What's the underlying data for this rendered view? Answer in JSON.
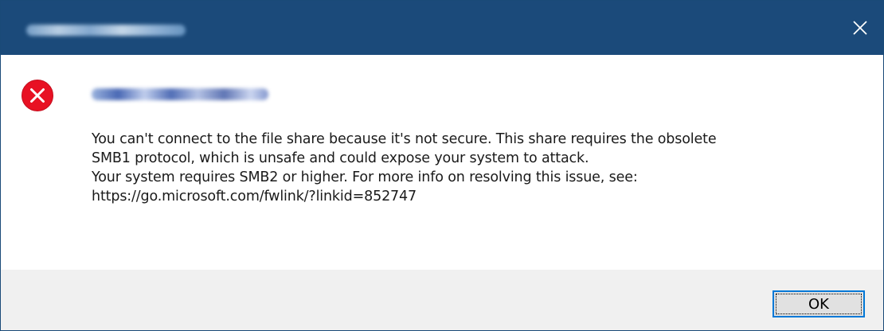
{
  "window": {
    "close_symbol": "✕",
    "close_icon": "close-icon"
  },
  "dialog": {
    "icon": "error-icon",
    "message_lines": [
      "You can't connect to the file share because it's not secure. This share requires the obsolete",
      "SMB1 protocol, which is unsafe and could expose your system to attack.",
      "Your system requires SMB2 or higher. For more info on resolving this issue, see:",
      "https://go.microsoft.com/fwlink/?linkid=852747"
    ],
    "ok_label": "OK"
  },
  "colors": {
    "titlebar": "#1b4a7a",
    "error_red": "#e81123",
    "footer": "#f0f0f0",
    "button_focus": "#0078d7"
  }
}
